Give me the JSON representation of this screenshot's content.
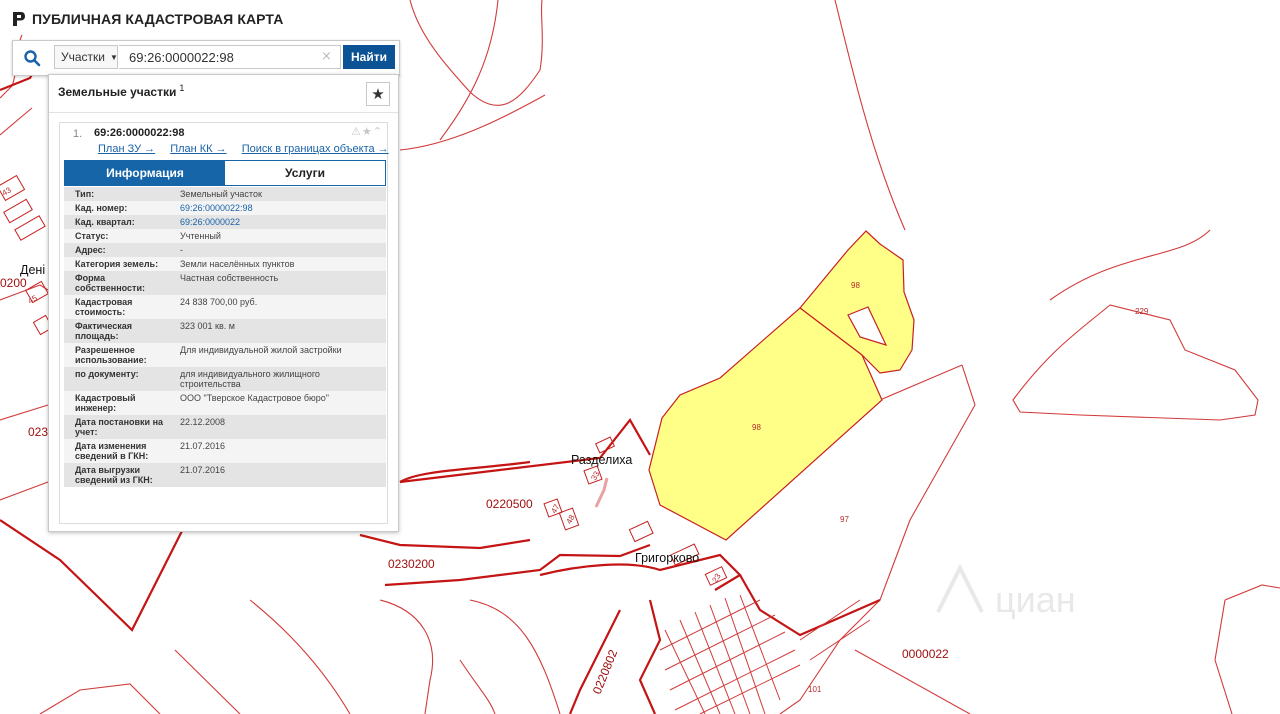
{
  "app": {
    "title": "ПУБЛИЧНАЯ КАДАСТРОВАЯ КАРТА"
  },
  "search": {
    "type_label": "Участки",
    "query": "69:26:0000022:98",
    "clear_glyph": "×",
    "submit_label": "Найти"
  },
  "panel": {
    "title": "Земельные участки",
    "count": "1",
    "favorite_glyph": "★"
  },
  "result": {
    "index": "1.",
    "cad_number": "69:26:0000022:98",
    "icons": "⚠★⌃",
    "links": [
      "План ЗУ →",
      "План КК →",
      "Поиск в границах объекта →"
    ],
    "tabs": [
      {
        "label": "Информация",
        "active": true
      },
      {
        "label": "Услуги",
        "active": false
      }
    ],
    "fields": [
      {
        "label": "Тип:",
        "value": "Земельный участок"
      },
      {
        "label": "Кад. номер:",
        "value": "69:26:0000022:98",
        "is_link": true
      },
      {
        "label": "Кад. квартал:",
        "value": "69:26:0000022",
        "is_link": true
      },
      {
        "label": "Статус:",
        "value": "Учтенный"
      },
      {
        "label": "Адрес:",
        "value": "-"
      },
      {
        "label": "Категория земель:",
        "value": "Земли населённых пунктов"
      },
      {
        "label": "Форма собственности:",
        "value": "Частная собственность"
      },
      {
        "label": "Кадастровая стоимость:",
        "value": "24 838 700,00 руб."
      },
      {
        "label": "Фактическая площадь:",
        "value": "323 001 кв. м"
      },
      {
        "label": "Разрешенное использование:",
        "value": "Для индивидуальной жилой застройки"
      },
      {
        "label": "по документу:",
        "value": "для индивидуального жилищного строительства"
      },
      {
        "label": "Кадастровый инженер:",
        "value": "ООО \"Тверское Кадастровое бюро\""
      },
      {
        "label": "Дата постановки на учет:",
        "value": "22.12.2008"
      },
      {
        "label": "Дата изменения сведений в ГКН:",
        "value": "21.07.2016"
      },
      {
        "label": "Дата выгрузки сведений из ГКН:",
        "value": "21.07.2016"
      }
    ]
  },
  "map": {
    "places": [
      "Разделиха",
      "Григорково",
      "Дені"
    ],
    "quarters": [
      "0220500",
      "0230200",
      "0220802",
      "0000022",
      "0200",
      "023"
    ],
    "parcels": [
      "98",
      "98",
      "97",
      "229",
      "101",
      "43",
      "45",
      "47",
      "48",
      "33",
      "23"
    ],
    "watermark": "циан"
  },
  "colors": {
    "boundary": "#cc1f1f",
    "selected_fill": "#ffff88",
    "accent": "#0b5394"
  }
}
